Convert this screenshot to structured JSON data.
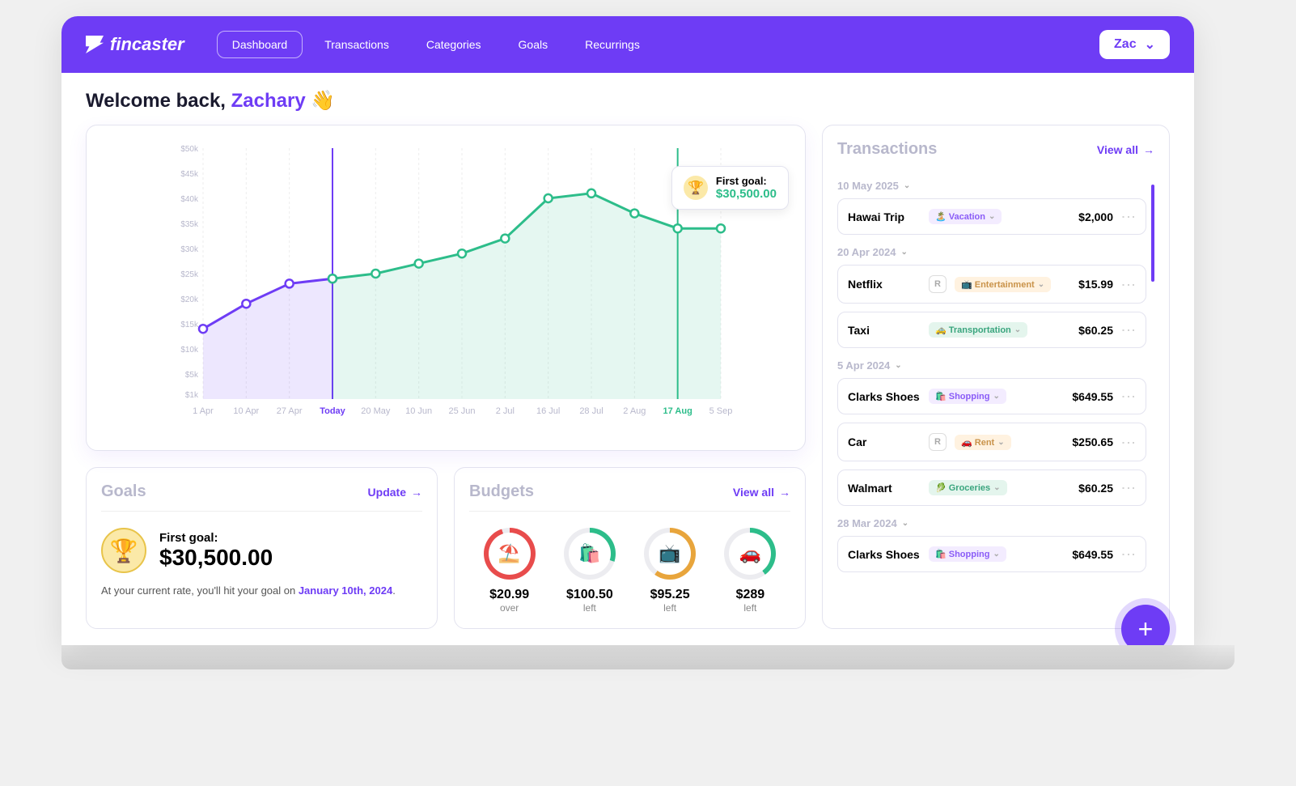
{
  "brand": "fincaster",
  "nav": {
    "items": [
      "Dashboard",
      "Transactions",
      "Categories",
      "Goals",
      "Recurrings"
    ],
    "active": 0
  },
  "user": {
    "short": "Zac",
    "full": "Zachary"
  },
  "welcome": {
    "prefix": "Welcome back, ",
    "emoji": "👋"
  },
  "chart_data": {
    "type": "area",
    "x_labels": [
      "1 Apr",
      "10 Apr",
      "27 Apr",
      "Today",
      "20 May",
      "10 Jun",
      "25 Jun",
      "2 Jul",
      "16 Jul",
      "28 Jul",
      "2 Aug",
      "17 Aug",
      "5 Sep"
    ],
    "y_ticks": [
      "$1k",
      "$5k",
      "$10k",
      "$15k",
      "$20k",
      "$25k",
      "$30k",
      "$35k",
      "$40k",
      "$45k",
      "$50k"
    ],
    "series": [
      {
        "name": "past",
        "color": "#6e3cf5",
        "x": [
          0,
          1,
          2,
          3
        ],
        "y": [
          14,
          19,
          23,
          24
        ]
      },
      {
        "name": "forecast",
        "color": "#2dbd8a",
        "x": [
          3,
          4,
          5,
          6,
          7,
          8,
          9,
          10,
          11,
          12
        ],
        "y": [
          24,
          25,
          27,
          29,
          32,
          40,
          41,
          37,
          34,
          34
        ]
      }
    ],
    "today_index": 3,
    "goal_marker": {
      "index": 11,
      "label": "17 Aug"
    },
    "ylim": [
      0,
      50
    ]
  },
  "goal_popup": {
    "title": "First goal:",
    "amount": "$30,500.00"
  },
  "goals": {
    "title": "Goals",
    "action": "Update",
    "first_label": "First goal:",
    "first_amount": "$30,500.00",
    "note_prefix": "At your current rate, you'll hit your goal on ",
    "note_date": "January 10th, 2024",
    "note_suffix": "."
  },
  "budgets": {
    "title": "Budgets",
    "action": "View all",
    "items": [
      {
        "emoji": "⛱️",
        "amount": "$20.99",
        "status": "over",
        "color": "#e84c4c",
        "pct": 95
      },
      {
        "emoji": "🛍️",
        "amount": "$100.50",
        "status": "left",
        "color": "#2dbd8a",
        "pct": 30
      },
      {
        "emoji": "📺",
        "amount": "$95.25",
        "status": "left",
        "color": "#e8a53c",
        "pct": 60
      },
      {
        "emoji": "🚗",
        "amount": "$289",
        "status": "left",
        "color": "#2dbd8a",
        "pct": 40
      }
    ]
  },
  "transactions": {
    "title": "Transactions",
    "action": "View all",
    "groups": [
      {
        "date": "10 May 2025",
        "items": [
          {
            "name": "Hawai Trip",
            "tag": "Vacation",
            "tag_emoji": "🏝️",
            "tag_class": "tag-vacation",
            "amount": "$2,000",
            "r": false
          }
        ]
      },
      {
        "date": "20 Apr 2024",
        "items": [
          {
            "name": "Netflix",
            "tag": "Entertainment",
            "tag_emoji": "📺",
            "tag_class": "tag-ent",
            "amount": "$15.99",
            "r": true
          },
          {
            "name": "Taxi",
            "tag": "Transportation",
            "tag_emoji": "🚕",
            "tag_class": "tag-trans",
            "amount": "$60.25",
            "r": false
          }
        ]
      },
      {
        "date": "5 Apr 2024",
        "items": [
          {
            "name": "Clarks Shoes",
            "tag": "Shopping",
            "tag_emoji": "🛍️",
            "tag_class": "tag-shop",
            "amount": "$649.55",
            "r": false
          },
          {
            "name": "Car",
            "tag": "Rent",
            "tag_emoji": "🚗",
            "tag_class": "tag-rent",
            "amount": "$250.65",
            "r": true
          },
          {
            "name": "Walmart",
            "tag": "Groceries",
            "tag_emoji": "🥬",
            "tag_class": "tag-groc",
            "amount": "$60.25",
            "r": false
          }
        ]
      },
      {
        "date": "28 Mar 2024",
        "items": [
          {
            "name": "Clarks Shoes",
            "tag": "Shopping",
            "tag_emoji": "🛍️",
            "tag_class": "tag-shop",
            "amount": "$649.55",
            "r": false
          }
        ]
      }
    ]
  }
}
